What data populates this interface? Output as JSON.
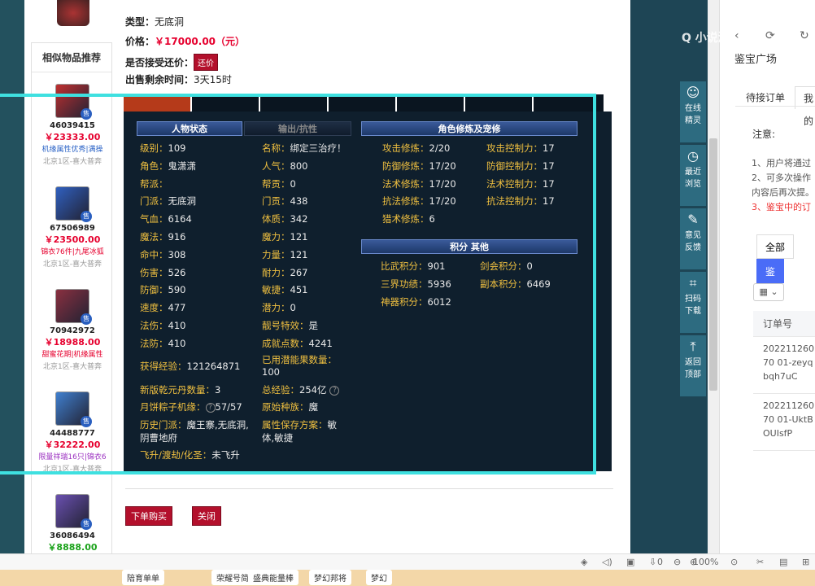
{
  "listing": {
    "type_label": "类型：",
    "type_value": "无底洞",
    "price_label": "价格：",
    "price_value": "￥17000.00（元）",
    "bargain_label": "是否接受还价：",
    "bargain_button": "还价",
    "remaining_label": "出售剩余时间：",
    "remaining_value": "3天15时"
  },
  "recommend": {
    "title": "相似物品推荐",
    "items": [
      {
        "id": "46039415",
        "price": "￥23333.00",
        "tags": "机缘属性优秀|满操",
        "server": "北京1区-喜大普奔",
        "price_style": "red"
      },
      {
        "id": "67506989",
        "price": "￥23500.00",
        "tags": "锦衣76件|九尾冰狐",
        "server": "北京1区-喜大普奔",
        "price_style": "red"
      },
      {
        "id": "70942972",
        "price": "￥18988.00",
        "tags": "甜蜜花期|机缘属性",
        "server": "北京1区-喜大普奔",
        "price_style": "red"
      },
      {
        "id": "44488777",
        "price": "￥32222.00",
        "tags": "限量祥瑞16只|锦衣6",
        "server": "北京1区-喜大普奔",
        "price_style": "red"
      },
      {
        "id": "36086494",
        "price": "￥8888.00",
        "tags": "",
        "server": "",
        "price_style": "green"
      }
    ],
    "sell_badge": "售"
  },
  "panel": {
    "headers": {
      "status": "人物状态",
      "output": "输出/抗性",
      "cultivation": "角色修炼及宠修",
      "points": "积分 其他"
    },
    "left_stats": [
      {
        "k": "级别：",
        "v": "109"
      },
      {
        "k": "角色：",
        "v": "鬼潇潇"
      },
      {
        "k": "帮派：",
        "v": ""
      },
      {
        "k": "门派：",
        "v": "无底洞"
      },
      {
        "k": "气血：",
        "v": "6164"
      },
      {
        "k": "魔法：",
        "v": "916"
      },
      {
        "k": "命中：",
        "v": "308"
      },
      {
        "k": "伤害：",
        "v": "526"
      },
      {
        "k": "防御：",
        "v": "590"
      },
      {
        "k": "速度：",
        "v": "477"
      },
      {
        "k": "法伤：",
        "v": "410"
      },
      {
        "k": "法防：",
        "v": "410"
      }
    ],
    "mid_stats": [
      {
        "k": "名称：",
        "v": "绑定三治疗！"
      },
      {
        "k": "人气：",
        "v": "800"
      },
      {
        "k": "帮贡：",
        "v": "0"
      },
      {
        "k": "门贡：",
        "v": "438"
      },
      {
        "k": "体质：",
        "v": "342"
      },
      {
        "k": "魔力：",
        "v": "121"
      },
      {
        "k": "力量：",
        "v": "121"
      },
      {
        "k": "耐力：",
        "v": "267"
      },
      {
        "k": "敏捷：",
        "v": "451"
      },
      {
        "k": "潜力：",
        "v": "0"
      },
      {
        "k": "靓号特效：",
        "v": "是"
      },
      {
        "k": "成就点数：",
        "v": "4241"
      }
    ],
    "extra_left": [
      {
        "k": "获得经验：",
        "v": "121264871"
      },
      {
        "k": "新版乾元丹数量：",
        "v": "3"
      },
      {
        "k": "月饼粽子机缘：",
        "v": "57/57"
      },
      {
        "k": "历史门派：",
        "v": "魔王寨,无底洞,"
      },
      {
        "k": "",
        "v": "阴曹地府"
      },
      {
        "k": "飞升/渡劫/化圣：",
        "v": "未飞升"
      }
    ],
    "extra_mid": [
      {
        "k": "已用潜能果数量：",
        "v": ""
      },
      {
        "k": "",
        "v": "100"
      },
      {
        "k": "总经验：",
        "v": "254亿"
      },
      {
        "k": "原始种族：",
        "v": "魔"
      },
      {
        "k": "属性保存方案：",
        "v": "敏"
      },
      {
        "k": "",
        "v": "体,敏捷"
      }
    ],
    "cultivation": [
      {
        "k1": "攻击修炼：",
        "v1": "2/20",
        "k2": "攻击控制力：",
        "v2": "17"
      },
      {
        "k1": "防御修炼：",
        "v1": "17/20",
        "k2": "防御控制力：",
        "v2": "17"
      },
      {
        "k1": "法术修炼：",
        "v1": "17/20",
        "k2": "法术控制力：",
        "v2": "17"
      },
      {
        "k1": "抗法修炼：",
        "v1": "17/20",
        "k2": "抗法控制力：",
        "v2": "17"
      },
      {
        "k1": "猎术修炼：",
        "v1": "6",
        "k2": "",
        "v2": ""
      }
    ],
    "points": [
      {
        "k1": "比武积分：",
        "v1": "901",
        "k2": "剑会积分：",
        "v2": "0"
      },
      {
        "k1": "三界功绩：",
        "v1": "5936",
        "k2": "副本积分：",
        "v2": "6469"
      },
      {
        "k1": "神器积分：",
        "v1": "6012",
        "k2": "",
        "v2": ""
      }
    ],
    "help_icon": "?"
  },
  "actions": {
    "buy": "下单购买",
    "close": "关闭"
  },
  "float_bar": [
    {
      "icon": "genie-icon",
      "label1": "在线",
      "label2": "精灵"
    },
    {
      "icon": "clock-icon",
      "label1": "最近",
      "label2": "浏览"
    },
    {
      "icon": "edit-icon",
      "label1": "意见",
      "label2": "反馈"
    },
    {
      "icon": "scan-icon",
      "label1": "扫码",
      "label2": "下载"
    },
    {
      "icon": "top-icon",
      "label1": "返回",
      "label2": "顶部"
    }
  ],
  "side": {
    "title": "鉴宝广场",
    "tabs": [
      "待接订单",
      "我的"
    ],
    "note_title": "注意:",
    "notes": [
      "1、用户将通过",
      "2、可多次操作",
      "内容后再次提。",
      "3、鉴宝中的订"
    ],
    "filter_all": "全部",
    "filter_active": "鉴",
    "order_header": "订单号",
    "orders": [
      "20221126070 01-zeyqbqh7uC",
      "20221126070 01-UktBOUIsfP"
    ]
  },
  "statusbar": {
    "counter": "0",
    "zoom": "100%"
  },
  "bottom_strip": [
    "陪育单单",
    "荣耀号简",
    "盛典能量棒",
    "梦幻邦将",
    "梦幻"
  ],
  "watermark": "Q 小说游"
}
